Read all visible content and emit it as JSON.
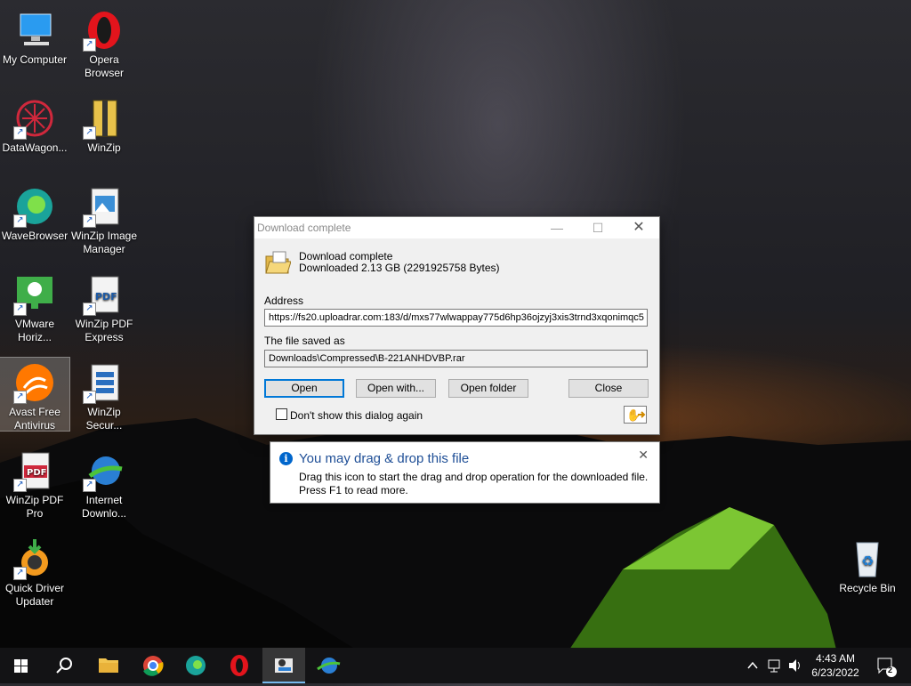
{
  "desktop": {
    "icons": [
      {
        "label_lines": [
          "My Computer"
        ],
        "icon": "computer-icon"
      },
      {
        "label_lines": [
          "Opera",
          "Browser"
        ],
        "icon": "opera-icon"
      },
      {
        "label_lines": [
          "DataWagon..."
        ],
        "icon": "datawagon-icon"
      },
      {
        "label_lines": [
          "WinZip"
        ],
        "icon": "winzip-icon"
      },
      {
        "label_lines": [
          "WaveBrowser"
        ],
        "icon": "wavebrowser-icon"
      },
      {
        "label_lines": [
          "WinZip Image",
          "Manager"
        ],
        "icon": "winzip-image-icon"
      },
      {
        "label_lines": [
          "VMware",
          "Horiz..."
        ],
        "icon": "vmware-icon"
      },
      {
        "label_lines": [
          "WinZip PDF",
          "Express"
        ],
        "icon": "winzip-pdf-express-icon"
      },
      {
        "label_lines": [
          "Avast Free",
          "Antivirus"
        ],
        "icon": "avast-icon"
      },
      {
        "label_lines": [
          "WinZip",
          "Secur..."
        ],
        "icon": "winzip-secure-icon"
      },
      {
        "label_lines": [
          "WinZip PDF",
          "Pro"
        ],
        "icon": "winzip-pdf-pro-icon"
      },
      {
        "label_lines": [
          "Internet",
          "Downlo..."
        ],
        "icon": "idm-icon"
      },
      {
        "label_lines": [
          "Quick Driver",
          "Updater"
        ],
        "icon": "quick-driver-icon"
      },
      {
        "label_lines": [
          "Recycle Bin"
        ],
        "icon": "recycle-bin-icon"
      }
    ]
  },
  "dialog": {
    "title": "Download complete",
    "heading": "Download complete",
    "size_text": "Downloaded 2.13  GB (2291925758 Bytes)",
    "address_label": "Address",
    "address_value": "https://fs20.uploadrar.com:183/d/mxs77wlwappay775d6hp36ojzyj3xis3trnd3xqonimqc5",
    "saved_label": "The file saved as",
    "saved_value": "Downloads\\Compressed\\B-221ANHDVBP.rar",
    "buttons": {
      "open": "Open",
      "open_with": "Open with...",
      "open_folder": "Open folder",
      "close": "Close"
    },
    "checkbox_label": "Don't show this dialog again",
    "checkbox_checked": false
  },
  "tooltip": {
    "title": "You may drag & drop this file",
    "body_line1": "Drag this icon to start the drag and drop operation for the downloaded file.",
    "body_line2": "Press F1 to read more."
  },
  "taskbar": {
    "items": [
      "start-icon",
      "search-icon",
      "file-explorer-icon",
      "chrome-icon",
      "edge-icon",
      "opera-icon",
      "idm-downloader-icon",
      "idm-icon"
    ],
    "time": "4:43 AM",
    "date": "6/23/2022",
    "notification_count": "2"
  },
  "colors": {
    "accent": "#0078d7",
    "tooltip_title": "#1e4e96"
  }
}
